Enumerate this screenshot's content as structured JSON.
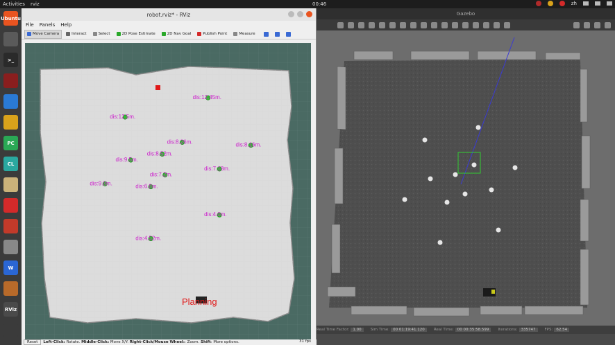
{
  "topbar": {
    "activities": "Activities",
    "app": "rviz",
    "clock": "00:46",
    "lang": "zh"
  },
  "dock": [
    {
      "name": "ubuntu-software-icon",
      "color": "#e95420",
      "label": "Ubuntu"
    },
    {
      "name": "files-icon",
      "color": "#5a5a5a",
      "label": ""
    },
    {
      "name": "terminal-icon",
      "color": "#2a2a2a",
      "label": ">_"
    },
    {
      "name": "system-monitor-icon",
      "color": "#8a1e1e",
      "label": ""
    },
    {
      "name": "vscode-icon",
      "color": "#2a7ad4",
      "label": ""
    },
    {
      "name": "chrome-icon",
      "color": "#d9a21b",
      "label": ""
    },
    {
      "name": "pycharm-icon",
      "color": "#2aa855",
      "label": "PC"
    },
    {
      "name": "clion-icon",
      "color": "#2aa8a0",
      "label": "CL"
    },
    {
      "name": "text-editor-icon",
      "color": "#cbb27a",
      "label": ""
    },
    {
      "name": "netease-music-icon",
      "color": "#d42a2a",
      "label": ""
    },
    {
      "name": "office-icon",
      "color": "#c23a2a",
      "label": ""
    },
    {
      "name": "screenshot-icon",
      "color": "#888888",
      "label": ""
    },
    {
      "name": "wps-icon",
      "color": "#2a66d4",
      "label": "W"
    },
    {
      "name": "globe-icon",
      "color": "#b86a2a",
      "label": ""
    },
    {
      "name": "rviz-icon",
      "color": "#4a4a4a",
      "label": "RViz"
    },
    {
      "name": "app-grid-icon",
      "color": "#3b3b3b",
      "label": ""
    }
  ],
  "rviz": {
    "title": "robot.rviz* - RViz",
    "menu": [
      "File",
      "Panels",
      "Help"
    ],
    "tools": [
      {
        "name": "tool-move-camera",
        "label": "Move Camera",
        "color": "#3a6ad4",
        "active": true
      },
      {
        "name": "tool-interact",
        "label": "Interact",
        "color": "#666",
        "active": false
      },
      {
        "name": "tool-select",
        "label": "Select",
        "color": "#888",
        "active": false
      },
      {
        "name": "tool-2d-pose-estimate",
        "label": "2D Pose Estimate",
        "color": "#2aa82a",
        "active": false
      },
      {
        "name": "tool-2d-nav-goal",
        "label": "2D Nav Goal",
        "color": "#2aa82a",
        "active": false
      },
      {
        "name": "tool-publish-point",
        "label": "Publish Point",
        "color": "#d42a2a",
        "active": false
      },
      {
        "name": "tool-measure",
        "label": "Measure",
        "color": "#888",
        "active": false
      }
    ],
    "status": {
      "reset": "Reset",
      "hint_b1": "Left-Click:",
      "hint_t1": " Rotate. ",
      "hint_b2": "Middle-Click:",
      "hint_t2": " Move X/Y. ",
      "hint_b3": "Right-Click/Mouse Wheel:",
      "hint_t3": ": Zoom. ",
      "hint_b4": "Shift",
      "hint_t4": ": More options.",
      "fps": "31 fps"
    },
    "planning_label": "Planning",
    "label_color": "#cc22cc",
    "goals": [
      {
        "id": "goal-1",
        "text": "dis:12.45m.",
        "mx": 0.64,
        "my": 0.185
      },
      {
        "id": "goal-2",
        "text": "dis:12.5m.",
        "mx": 0.35,
        "my": 0.25
      },
      {
        "id": "goal-3",
        "text": "dis:8.26m.",
        "mx": 0.55,
        "my": 0.335
      },
      {
        "id": "goal-4",
        "text": "dis:8.16m.",
        "mx": 0.79,
        "my": 0.345
      },
      {
        "id": "goal-5",
        "text": "dis:8.52m.",
        "mx": 0.48,
        "my": 0.375
      },
      {
        "id": "goal-6",
        "text": "dis:9.5m.",
        "mx": 0.37,
        "my": 0.395
      },
      {
        "id": "goal-7",
        "text": "dis:7.18m.",
        "mx": 0.68,
        "my": 0.425
      },
      {
        "id": "goal-8",
        "text": "dis:7.2m.",
        "mx": 0.49,
        "my": 0.445
      },
      {
        "id": "goal-9",
        "text": "dis:9.8m.",
        "mx": 0.28,
        "my": 0.475
      },
      {
        "id": "goal-10",
        "text": "dis:6.8m.",
        "mx": 0.44,
        "my": 0.485
      },
      {
        "id": "goal-11",
        "text": "dis:4.0m.",
        "mx": 0.68,
        "my": 0.58
      },
      {
        "id": "goal-12",
        "text": "dis:4.52m.",
        "mx": 0.44,
        "my": 0.66
      }
    ]
  },
  "gazebo": {
    "title": "Gazebo",
    "status": {
      "rtf_label": "Real Time Factor:",
      "rtf": "1.00",
      "sim_label": "Sim Time:",
      "sim": "00 01:19:41.120",
      "real_label": "Real Time:",
      "real": "00 00:35:58.599",
      "iter_label": "Iterations:",
      "iter": "335747",
      "fps_label": "FPS:",
      "fps": "62.54"
    }
  }
}
